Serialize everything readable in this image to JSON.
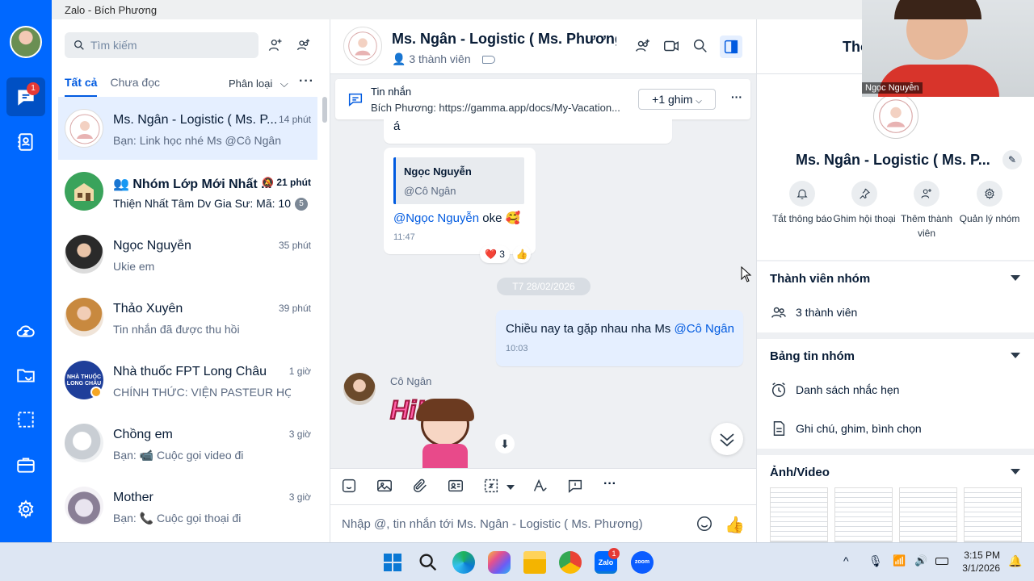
{
  "window": {
    "title": "Zalo - Bích Phương"
  },
  "rail": {
    "chat_badge": "1"
  },
  "search": {
    "placeholder": "Tìm kiếm"
  },
  "tabs": {
    "all": "Tất cả",
    "unread": "Chưa đọc",
    "filter": "Phân loại",
    "more": "···"
  },
  "conversations": [
    {
      "name": "Ms. Ngân - Logistic ( Ms. P...",
      "time": "14 phút",
      "preview": "Bạn: Link học nhé Ms @Cô Ngân",
      "active": true
    },
    {
      "name": "Nhóm Lớp Mới Nhất ...",
      "time": "21 phút",
      "preview": "Thiện Nhất Tâm Dv Gia Sư: Mã: 10...",
      "unread": "5"
    },
    {
      "name": "Ngọc Nguyễn",
      "time": "35 phút",
      "preview": "Ukie em"
    },
    {
      "name": "Thảo Xuyên",
      "time": "39 phút",
      "preview": "Tin nhắn đã được thu hồi"
    },
    {
      "name": "Nhà thuốc FPT Long Châu",
      "time": "1 giờ",
      "preview": "CHÍNH THỨC: VIỆN PASTEUR HỢP TÁ..."
    },
    {
      "name": "Chồng em",
      "time": "3 giờ",
      "preview": "Bạn: 📹 Cuộc gọi video đi"
    },
    {
      "name": "Mother",
      "time": "3 giờ",
      "preview": "Bạn: 📞 Cuộc gọi thoại đi"
    }
  ],
  "chat": {
    "title": "Ms. Ngân - Logistic ( Ms. Phương)",
    "members": "3 thành viên",
    "pinned": {
      "label": "Tin nhắn",
      "text": "Bích Phương: https://gamma.app/docs/My-Vacation...",
      "button": "+1 ghim"
    },
    "msg_top": "á",
    "reply": {
      "quote_name": "Ngọc Nguyễn",
      "quote_text": "@Cô Ngân",
      "mention": "@Ngọc Nguyễn",
      "text": " oke 🥰",
      "time": "11:47",
      "reactions": "❤️ 3"
    },
    "date": "T7 28/02/2026",
    "mine": {
      "text": "Chiều nay ta gặp nhau nha Ms ",
      "mention": "@Cô Ngân",
      "time": "10:03"
    },
    "sender": "Cô Ngân",
    "sticker_text": "Hi!",
    "composer_placeholder": "Nhập @, tin nhắn tới Ms. Ngân - Logistic ( Ms. Phương)"
  },
  "info": {
    "header_partial": "Thô",
    "group_name": "Ms. Ngân - Logistic ( Ms. P...",
    "actions": [
      {
        "label": "Tắt thông báo",
        "icon": "bell-icon"
      },
      {
        "label": "Ghim hội thoại",
        "icon": "pin-icon"
      },
      {
        "label": "Thêm thành viên",
        "icon": "add-user-icon"
      },
      {
        "label": "Quản lý nhóm",
        "icon": "gear-icon"
      }
    ],
    "members_title": "Thành viên nhóm",
    "members_count": "3 thành viên",
    "board_title": "Bảng tin nhóm",
    "reminders": "Danh sách nhắc hẹn",
    "notes": "Ghi chú, ghim, bình chọn",
    "media_title": "Ảnh/Video"
  },
  "video_overlay": {
    "name": "Ngọc Nguyễn"
  },
  "taskbar": {
    "time": "3:15 PM",
    "date": "3/1/2026",
    "zalo_badge": "1"
  }
}
